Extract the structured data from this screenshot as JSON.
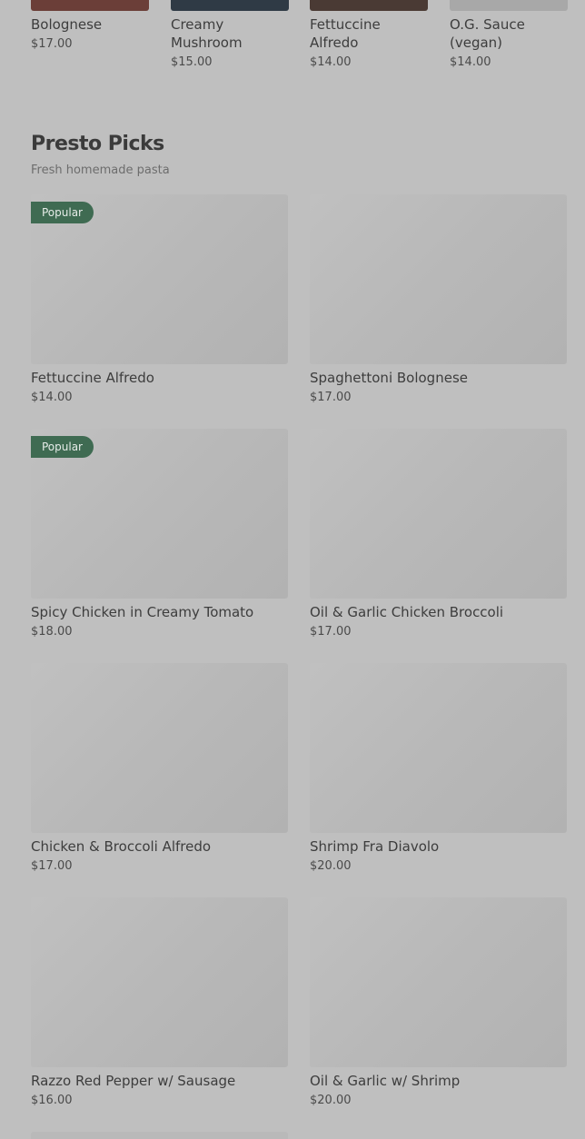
{
  "top_row": [
    {
      "name": "Bolognese",
      "price": "$17.00",
      "thumb_color": "#6b3e38"
    },
    {
      "name": "Creamy Mushroom",
      "price": "$15.00",
      "thumb_color": "#2f3a45"
    },
    {
      "name": "Fettuccine Alfredo",
      "price": "$14.00",
      "thumb_color": "#4a3a34"
    },
    {
      "name": "O.G. Sauce (vegan)",
      "price": "$14.00",
      "thumb_color": "#a8a8a8"
    }
  ],
  "section": {
    "title": "Presto Picks",
    "subtitle": "Fresh homemade pasta"
  },
  "cards": [
    {
      "name": "Fettuccine Alfredo",
      "price": "$14.00",
      "badge": "Popular"
    },
    {
      "name": "Spaghettoni Bolognese",
      "price": "$17.00",
      "badge": ""
    },
    {
      "name": "Spicy Chicken in Creamy Tomato",
      "price": "$18.00",
      "badge": "Popular"
    },
    {
      "name": "Oil & Garlic Chicken Broccoli",
      "price": "$17.00",
      "badge": ""
    },
    {
      "name": "Chicken & Broccoli Alfredo",
      "price": "$17.00",
      "badge": ""
    },
    {
      "name": "Shrimp Fra Diavolo",
      "price": "$20.00",
      "badge": ""
    },
    {
      "name": "Razzo Red Pepper w/ Sausage",
      "price": "$16.00",
      "badge": ""
    },
    {
      "name": "Oil & Garlic w/ Shrimp",
      "price": "$20.00",
      "badge": ""
    }
  ],
  "colors": {
    "badge_bg": "#3f6b52",
    "overlay": "#bfbfbf"
  }
}
